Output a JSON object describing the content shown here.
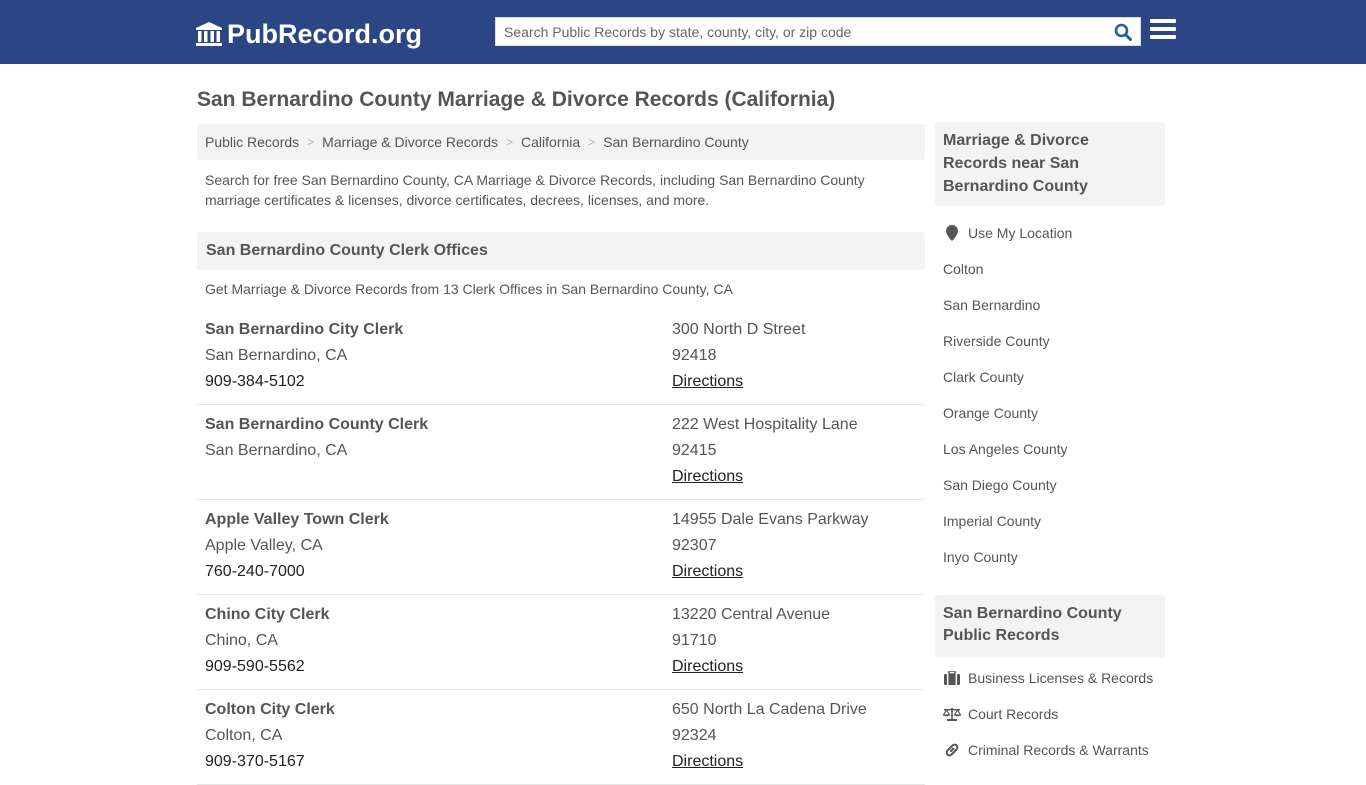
{
  "header": {
    "logo_text": "PubRecord.org",
    "search_placeholder": "Search Public Records by state, county, city, or zip code",
    "brand_color": "#2c4585"
  },
  "page_title": "San Bernardino County Marriage & Divorce Records (California)",
  "breadcrumb": [
    {
      "label": "Public Records"
    },
    {
      "label": "Marriage & Divorce Records"
    },
    {
      "label": "California"
    },
    {
      "label": "San Bernardino County"
    }
  ],
  "intro": "Search for free San Bernardino County, CA Marriage & Divorce Records, including San Bernardino County marriage certificates & licenses, divorce certificates, decrees, licenses, and more.",
  "clerk_section": {
    "title": "San Bernardino County Clerk Offices",
    "subtitle": "Get Marriage & Divorce Records from 13 Clerk Offices in San Bernardino County, CA",
    "directions_label": "Directions",
    "offices": [
      {
        "name": "San Bernardino City Clerk",
        "city": "San Bernardino, CA",
        "phone": "909-384-5102",
        "address": "300 North D Street",
        "zip": "92418"
      },
      {
        "name": "San Bernardino County Clerk",
        "city": "San Bernardino, CA",
        "phone": "",
        "address": "222 West Hospitality Lane",
        "zip": "92415"
      },
      {
        "name": "Apple Valley Town Clerk",
        "city": "Apple Valley, CA",
        "phone": "760-240-7000",
        "address": "14955 Dale Evans Parkway",
        "zip": "92307"
      },
      {
        "name": "Chino City Clerk",
        "city": "Chino, CA",
        "phone": "909-590-5562",
        "address": "13220 Central Avenue",
        "zip": "91710"
      },
      {
        "name": "Colton City Clerk",
        "city": "Colton, CA",
        "phone": "909-370-5167",
        "address": "650 North La Cadena Drive",
        "zip": "92324"
      }
    ]
  },
  "sidebar": {
    "nearby": {
      "title": "Marriage & Divorce Records near San Bernardino County",
      "use_location": "Use My Location",
      "items": [
        "Colton",
        "San Bernardino",
        "Riverside County",
        "Clark County",
        "Orange County",
        "Los Angeles County",
        "San Diego County",
        "Imperial County",
        "Inyo County"
      ]
    },
    "county_records": {
      "title": "San Bernardino County Public Records",
      "items": [
        {
          "label": "Business Licenses & Records",
          "icon": "briefcase-icon"
        },
        {
          "label": "Court Records",
          "icon": "scale-icon"
        },
        {
          "label": "Criminal Records & Warrants",
          "icon": "link-icon"
        }
      ]
    }
  }
}
